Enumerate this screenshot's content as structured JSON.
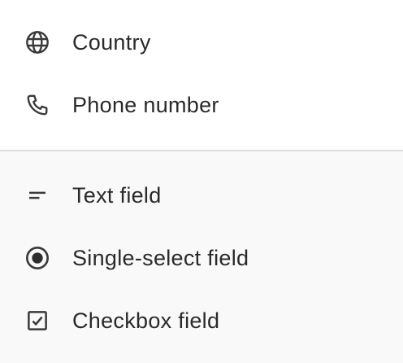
{
  "menu": {
    "group1": [
      {
        "label": "Country",
        "icon": "globe-icon"
      },
      {
        "label": "Phone number",
        "icon": "phone-icon"
      }
    ],
    "group2": [
      {
        "label": "Text field",
        "icon": "short-text-icon"
      },
      {
        "label": "Single-select field",
        "icon": "radio-button-icon"
      },
      {
        "label": "Checkbox field",
        "icon": "checkbox-icon"
      }
    ]
  },
  "colors": {
    "text": "#2a2a2a",
    "icon": "#3a3a3a",
    "divider": "#dcdcdc",
    "bottom_background": "#f9f9f9"
  }
}
